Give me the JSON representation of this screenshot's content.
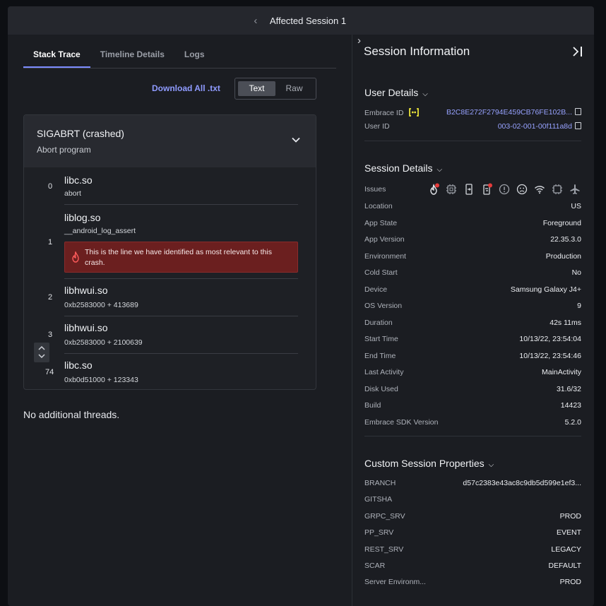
{
  "topbar": {
    "title": "Affected Session 1"
  },
  "tabs": [
    {
      "label": "Stack Trace"
    },
    {
      "label": "Timeline Details"
    },
    {
      "label": "Logs"
    }
  ],
  "toolbar": {
    "download_label": "Download All .txt",
    "view_options": [
      "Text",
      "Raw"
    ],
    "selected_view": "Text"
  },
  "crash": {
    "signal": "SIGABRT (crashed)",
    "description": "Abort program",
    "frames": [
      {
        "index": "0",
        "library": "libc.so",
        "detail": "abort"
      },
      {
        "index": "1",
        "library": "liblog.so",
        "detail": "__android_log_assert",
        "highlight": "This is the line we have identified as most relevant to this crash."
      },
      {
        "index": "2",
        "library": "libhwui.so",
        "detail": "0xb2583000 + 413689"
      },
      {
        "index": "3",
        "library": "libhwui.so",
        "detail": "0xb2583000 + 2100639"
      },
      {
        "index": "74",
        "library": "libc.so",
        "detail": "0xb0d51000 + 123343"
      }
    ],
    "no_threads": "No additional threads."
  },
  "session": {
    "title": "Session Information",
    "user_details": {
      "title": "User Details",
      "rows": [
        {
          "key": "Embrace ID",
          "value": "B2C8E272F2794E459CB76FE102B..."
        },
        {
          "key": "User ID",
          "value": "003-02-001-00f111a8d"
        }
      ]
    },
    "session_details": {
      "title": "Session Details",
      "issues_label": "Issues",
      "issue_icons": [
        "crash-icon",
        "cpu-icon",
        "exit-icon",
        "anr-icon",
        "warning-icon",
        "sad-face-icon",
        "wifi-icon",
        "chip-icon",
        "airplane-icon"
      ],
      "rows": [
        {
          "key": "Location",
          "value": "US"
        },
        {
          "key": "App State",
          "value": "Foreground"
        },
        {
          "key": "App Version",
          "value": "22.35.3.0"
        },
        {
          "key": "Environment",
          "value": "Production"
        },
        {
          "key": "Cold Start",
          "value": "No"
        },
        {
          "key": "Device",
          "value": "Samsung Galaxy J4+"
        },
        {
          "key": "OS Version",
          "value": "9"
        },
        {
          "key": "Duration",
          "value": "42s 11ms"
        },
        {
          "key": "Start Time",
          "value": "10/13/22, 23:54:04"
        },
        {
          "key": "End Time",
          "value": "10/13/22, 23:54:46"
        },
        {
          "key": "Last Activity",
          "value": "MainActivity"
        },
        {
          "key": "Disk Used",
          "value": "31.6/32"
        },
        {
          "key": "Build",
          "value": "14423"
        },
        {
          "key": "Embrace SDK Version",
          "value": "5.2.0"
        }
      ]
    },
    "custom_properties": {
      "title": "Custom Session Properties",
      "rows": [
        {
          "key": "BRANCH",
          "value": "d57c2383e43ac8c9db5d599e1ef3..."
        },
        {
          "key": "GITSHA",
          "value": ""
        },
        {
          "key": "GRPC_SRV",
          "value": "PROD"
        },
        {
          "key": "PP_SRV",
          "value": "EVENT"
        },
        {
          "key": "REST_SRV",
          "value": "LEGACY"
        },
        {
          "key": "SCAR",
          "value": "DEFAULT"
        },
        {
          "key": "Server Environm...",
          "value": "PROD"
        }
      ]
    }
  }
}
